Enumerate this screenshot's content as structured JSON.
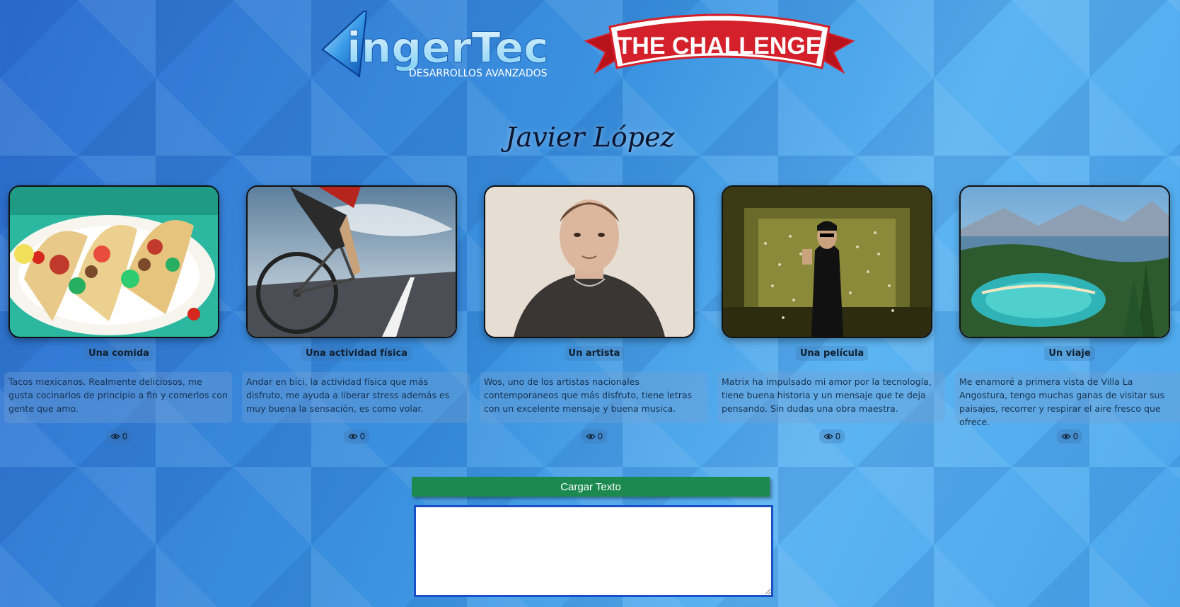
{
  "header": {
    "brand_name": "ingerTec",
    "brand_tagline": "DESARROLLOS AVANZADOS",
    "challenge_banner": "THE CHALLENGE"
  },
  "person": {
    "name": "Javier López"
  },
  "cards": [
    {
      "label": "Una comida",
      "image": "tacos-photo",
      "description": "Tacos mexicanos. Realmente deliciosos, me gusta cocinarlos de principio a fin y comerlos con gente que amo.",
      "views": "0"
    },
    {
      "label": "Una actividad física",
      "image": "cycling-photo",
      "description": "Andar en bici, la actividad física que más disfruto, me ayuda a liberar stress además es muy buena la sensación, es como volar.",
      "views": "0"
    },
    {
      "label": "Un artista",
      "image": "artist-portrait-photo",
      "description": "Wos, uno de los artistas nacionales contemporaneos que más disfruto, tiene letras con un excelente mensaje y buena musica.",
      "views": "0"
    },
    {
      "label": "Una película",
      "image": "matrix-movie-still",
      "description": "Matrix ha impulsado mi amor por la tecnología, tiene buena historia y un mensaje que te deja pensando. Sin dudas una obra maestra.",
      "views": "0"
    },
    {
      "label": "Un viaje",
      "image": "lake-landscape-photo",
      "description": "Me enamoré a primera vista de Villa La Angostura, tengo muchas ganas de visitar sus paisajes, recorrer y respirar el aire fresco que ofrece.",
      "views": "0"
    }
  ],
  "form": {
    "button_label": "Cargar Texto",
    "textarea_value": "",
    "textarea_placeholder": ""
  },
  "colors": {
    "button_bg": "#1c8a50",
    "banner_red": "#d4202a",
    "textarea_border": "#1a4fc8"
  }
}
